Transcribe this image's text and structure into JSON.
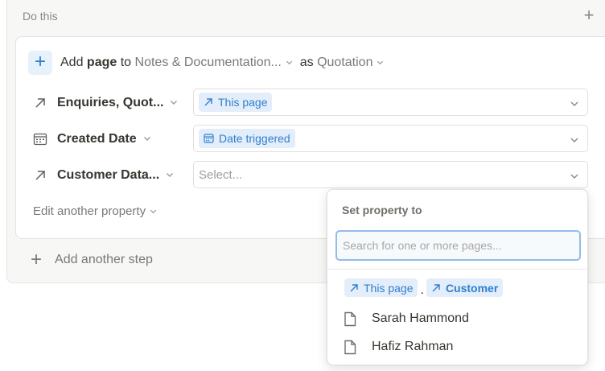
{
  "section": {
    "title": "Do this"
  },
  "action": {
    "verb": "Add",
    "object": "page",
    "prep": "to",
    "database": "Notes & Documentation...",
    "as_word": "as",
    "template": "Quotation"
  },
  "properties": [
    {
      "label": "Enquiries, Quot...",
      "icon": "relation-arrow-icon",
      "value_chip": "This page",
      "value_icon": "arrow-up-right-icon"
    },
    {
      "label": "Created Date",
      "icon": "calendar-icon",
      "value_chip": "Date triggered",
      "value_icon": "calendar-icon"
    },
    {
      "label": "Customer Data...",
      "icon": "relation-arrow-icon",
      "placeholder": "Select..."
    }
  ],
  "edit_property": "Edit another property",
  "add_step": "Add another step",
  "popup": {
    "title": "Set property to",
    "search_placeholder": "Search for one or more pages...",
    "chips": [
      "This page",
      "Customer"
    ],
    "separator": ".",
    "pages": [
      "Sarah Hammond",
      "Hafiz Rahman"
    ]
  },
  "colors": {
    "accent": "#2f7fcf",
    "chip_bg": "#e3eefa",
    "focus_border": "#93bce6"
  }
}
